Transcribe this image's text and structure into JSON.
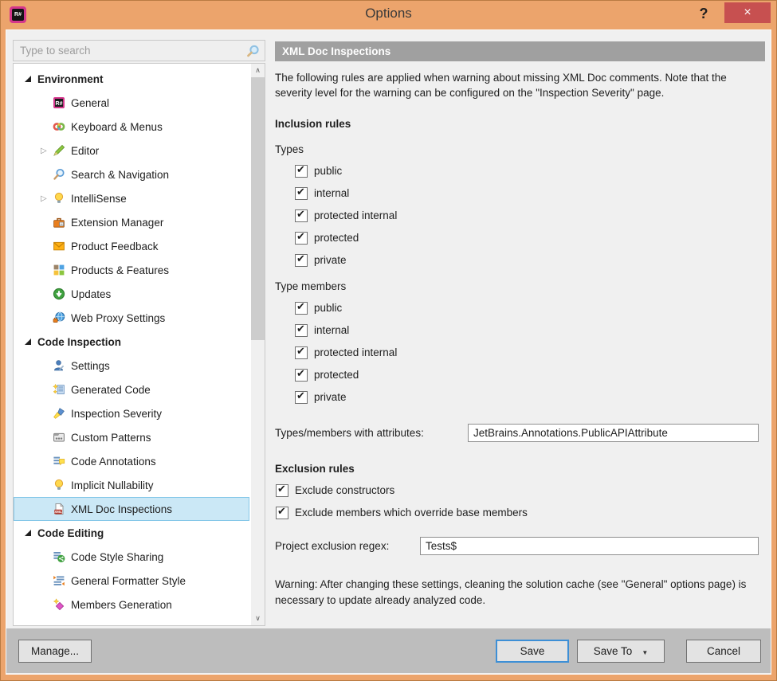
{
  "window": {
    "title": "Options",
    "help_glyph": "?",
    "close_glyph": "×",
    "app_logo_text": "R#"
  },
  "colors": {
    "frame_orange": "#ECA46C",
    "close_red": "#C75050",
    "selection_blue": "#CBE8F6",
    "selection_border": "#84C7E8",
    "panel_header_gray": "#A0A0A0",
    "footer_gray": "#BDBDBD",
    "save_focus_border": "#3D8FD6"
  },
  "sidebar": {
    "search": {
      "placeholder": "Type to search",
      "icon": "search-magnifier"
    },
    "scrollbar": {
      "up_glyph": "∧",
      "down_glyph": "∨"
    },
    "tree": [
      {
        "kind": "section",
        "label": "Environment"
      },
      {
        "kind": "item",
        "label": "General",
        "icon": "resharper-logo"
      },
      {
        "kind": "item",
        "label": "Keyboard & Menus",
        "icon": "keyboard-menus"
      },
      {
        "kind": "item",
        "label": "Editor",
        "icon": "editor-pencil",
        "expandable": true
      },
      {
        "kind": "item",
        "label": "Search & Navigation",
        "icon": "search-navigation"
      },
      {
        "kind": "item",
        "label": "IntelliSense",
        "icon": "intellisense-bulb",
        "expandable": true
      },
      {
        "kind": "item",
        "label": "Extension Manager",
        "icon": "extension-manager"
      },
      {
        "kind": "item",
        "label": "Product Feedback",
        "icon": "product-feedback"
      },
      {
        "kind": "item",
        "label": "Products & Features",
        "icon": "products-features"
      },
      {
        "kind": "item",
        "label": "Updates",
        "icon": "updates"
      },
      {
        "kind": "item",
        "label": "Web Proxy Settings",
        "icon": "web-proxy"
      },
      {
        "kind": "section",
        "label": "Code Inspection"
      },
      {
        "kind": "item",
        "label": "Settings",
        "icon": "settings-person"
      },
      {
        "kind": "item",
        "label": "Generated Code",
        "icon": "generated-code"
      },
      {
        "kind": "item",
        "label": "Inspection Severity",
        "icon": "inspection-severity"
      },
      {
        "kind": "item",
        "label": "Custom Patterns",
        "icon": "custom-patterns"
      },
      {
        "kind": "item",
        "label": "Code Annotations",
        "icon": "code-annotations"
      },
      {
        "kind": "item",
        "label": "Implicit Nullability",
        "icon": "implicit-nullability"
      },
      {
        "kind": "item",
        "label": "XML Doc Inspections",
        "icon": "xml-doc",
        "selected": true
      },
      {
        "kind": "section",
        "label": "Code Editing"
      },
      {
        "kind": "item",
        "label": "Code Style Sharing",
        "icon": "code-style-sharing"
      },
      {
        "kind": "item",
        "label": "General Formatter Style",
        "icon": "formatter-style"
      },
      {
        "kind": "item",
        "label": "Members Generation",
        "icon": "members-generation"
      }
    ],
    "collapsed_glyph": "▷"
  },
  "panel": {
    "title": "XML Doc Inspections",
    "description": "The following rules are applied when warning about missing XML Doc comments. Note that the severity level for the warning can be configured on the \"Inspection Severity\" page.",
    "inclusion_heading": "Inclusion rules",
    "types_label": "Types",
    "type_members_label": "Type members",
    "visibility_options": [
      "public",
      "internal",
      "protected internal",
      "protected",
      "private"
    ],
    "types_checked": [
      true,
      true,
      true,
      true,
      true
    ],
    "type_members_checked": [
      true,
      true,
      true,
      true,
      true
    ],
    "attributes_label": "Types/members with attributes:",
    "attributes_value": "JetBrains.Annotations.PublicAPIAttribute",
    "exclusion_heading": "Exclusion rules",
    "exclusion_options": [
      {
        "label": "Exclude constructors",
        "checked": true
      },
      {
        "label": "Exclude members which override base members",
        "checked": true
      }
    ],
    "regex_label": "Project exclusion regex:",
    "regex_value": "Tests$",
    "warning": "Warning: After changing these settings, cleaning the solution cache (see \"General\" options page) is necessary to update already analyzed code."
  },
  "footer": {
    "manage_label": "Manage...",
    "save_label": "Save",
    "save_to_label": "Save To",
    "save_to_arrow": "▼",
    "cancel_label": "Cancel"
  }
}
